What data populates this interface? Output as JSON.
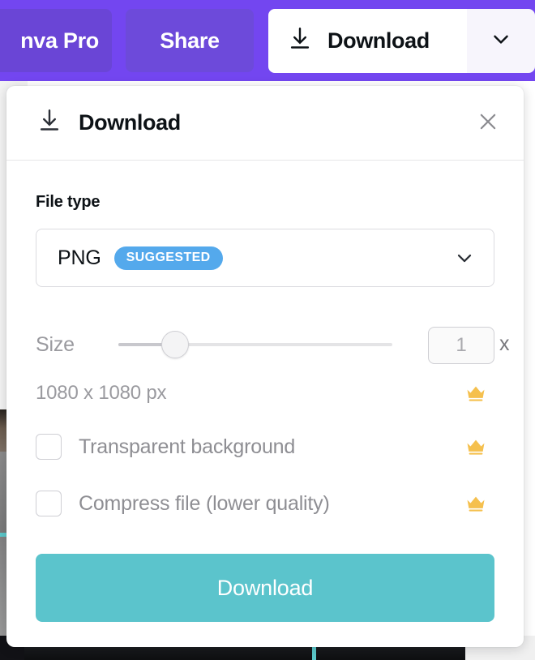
{
  "editor_topbar": {
    "canva_pro_label": "nva Pro",
    "share_label": "Share",
    "download_label": "Download",
    "download_icon": "download-arrow-icon",
    "caret_icon": "chevron-down-icon",
    "bar_color": "#7346f0"
  },
  "modal": {
    "title": "Download",
    "title_icon": "download-arrow-icon",
    "close_icon": "close-icon",
    "file_type": {
      "label": "File type",
      "selected": "PNG",
      "badge": "SUGGESTED",
      "badge_color": "#54a9ec",
      "caret_icon": "chevron-down-icon"
    },
    "size": {
      "label": "Size",
      "multiplier_value": "1",
      "multiplier_placeholder": "1",
      "unit": "x",
      "dimensions": "1080 x 1080 px",
      "dimensions_crown_icon": "crown-icon",
      "slider_min": 1,
      "slider_max": 5,
      "slider_value": 1
    },
    "options": [
      {
        "label": "Transparent background",
        "checked": false,
        "crown_icon": "crown-icon"
      },
      {
        "label": "Compress file (lower quality)",
        "checked": false,
        "crown_icon": "crown-icon"
      }
    ],
    "primary_button": {
      "label": "Download",
      "color": "#5bc4cc"
    }
  },
  "colors": {
    "accent_purple": "#7346f0",
    "accent_teal": "#5bc4cc",
    "badge_blue": "#54a9ec",
    "crown_gold": "#f5c04e"
  }
}
